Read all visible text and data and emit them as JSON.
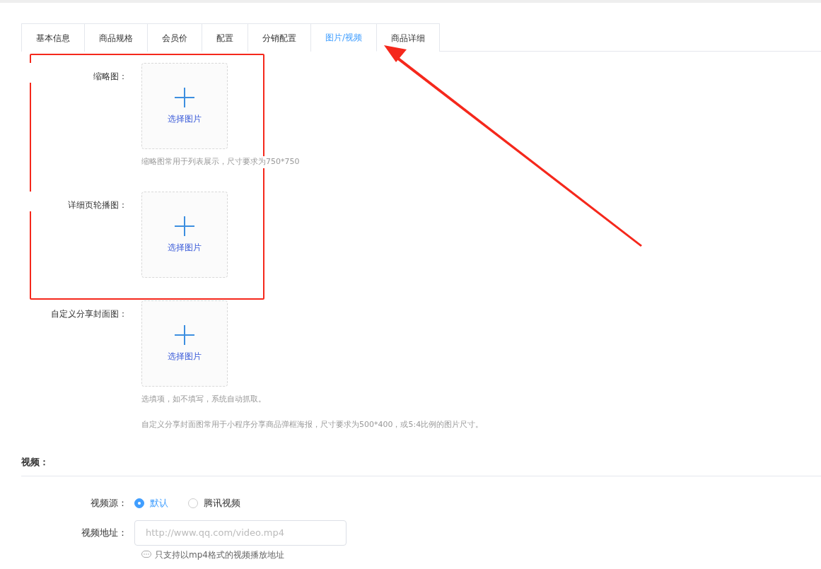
{
  "tabs": [
    {
      "label": "基本信息",
      "selected": false
    },
    {
      "label": "商品规格",
      "selected": false
    },
    {
      "label": "会员价",
      "selected": false
    },
    {
      "label": "配置",
      "selected": false
    },
    {
      "label": "分销配置",
      "selected": false
    },
    {
      "label": "图片/视频",
      "selected": true
    },
    {
      "label": "商品详细",
      "selected": false
    }
  ],
  "image_fields": [
    {
      "label": "缩略图：",
      "button": "选择图片",
      "hints": [
        "缩略图常用于列表展示，尺寸要求为750*750"
      ]
    },
    {
      "label": "详细页轮播图：",
      "button": "选择图片"
    },
    {
      "label": "自定义分享封面图：",
      "button": "选择图片",
      "hints": [
        "选填项，如不填写，系统自动抓取。",
        "自定义分享封面图常用于小程序分享商品弹框海报，尺寸要求为500*400，或5:4比例的图片尺寸。"
      ]
    }
  ],
  "video": {
    "heading": "视频：",
    "source_label": "视频源：",
    "sources": [
      {
        "label": "默认",
        "selected": true
      },
      {
        "label": "腾讯视频",
        "selected": false
      }
    ],
    "url_label": "视频地址：",
    "url_placeholder": "http://www.qq.com/video.mp4",
    "url_hint": "只支持以mp4格式的视频播放地址"
  }
}
